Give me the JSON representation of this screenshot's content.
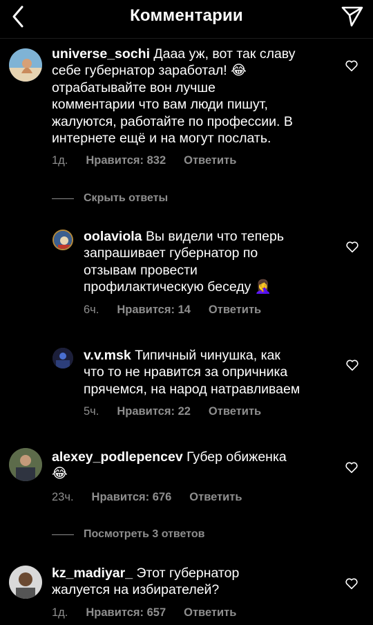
{
  "header": {
    "title": "Комментарии"
  },
  "comments": [
    {
      "username": "universe_sochi",
      "text": "Дааа уж, вот так славу\nсебе губернатор заработал! 😂\nотрабатывайте вон лучше\nкомментарии что вам люди пишут,\nжалуются, работайте по профессии. В\nинтернете ещё и на  могут послать.",
      "time": "1д.",
      "likes": "Нравится: 832",
      "reply": "Ответить"
    },
    {
      "username": "oolaviola",
      "text": "Вы видели что теперь\nзапрашивает губернатор по\nотзывам провести\nпрофилактическую беседу 🤦‍♀️",
      "time": "6ч.",
      "likes": "Нравится: 14",
      "reply": "Ответить"
    },
    {
      "username": "v.v.msk",
      "text": "Типичный чинушка, как\nчто то не нравится за опричника\nпрячемся, на народ натравливаем",
      "time": "5ч.",
      "likes": "Нравится: 22",
      "reply": "Ответить"
    },
    {
      "username": "alexey_podlepencev",
      "text": "Губер обиженка\n😂",
      "time": "23ч.",
      "likes": "Нравится: 676",
      "reply": "Ответить"
    },
    {
      "username": "kz_madiyar_",
      "text": "Этот губернатор\nжалуется на избирателей?",
      "time": "1д.",
      "likes": "Нравится: 657",
      "reply": "Ответить"
    }
  ],
  "threads": {
    "hide_replies": "Скрыть ответы",
    "view_replies": "Посмотреть 3 ответов"
  }
}
